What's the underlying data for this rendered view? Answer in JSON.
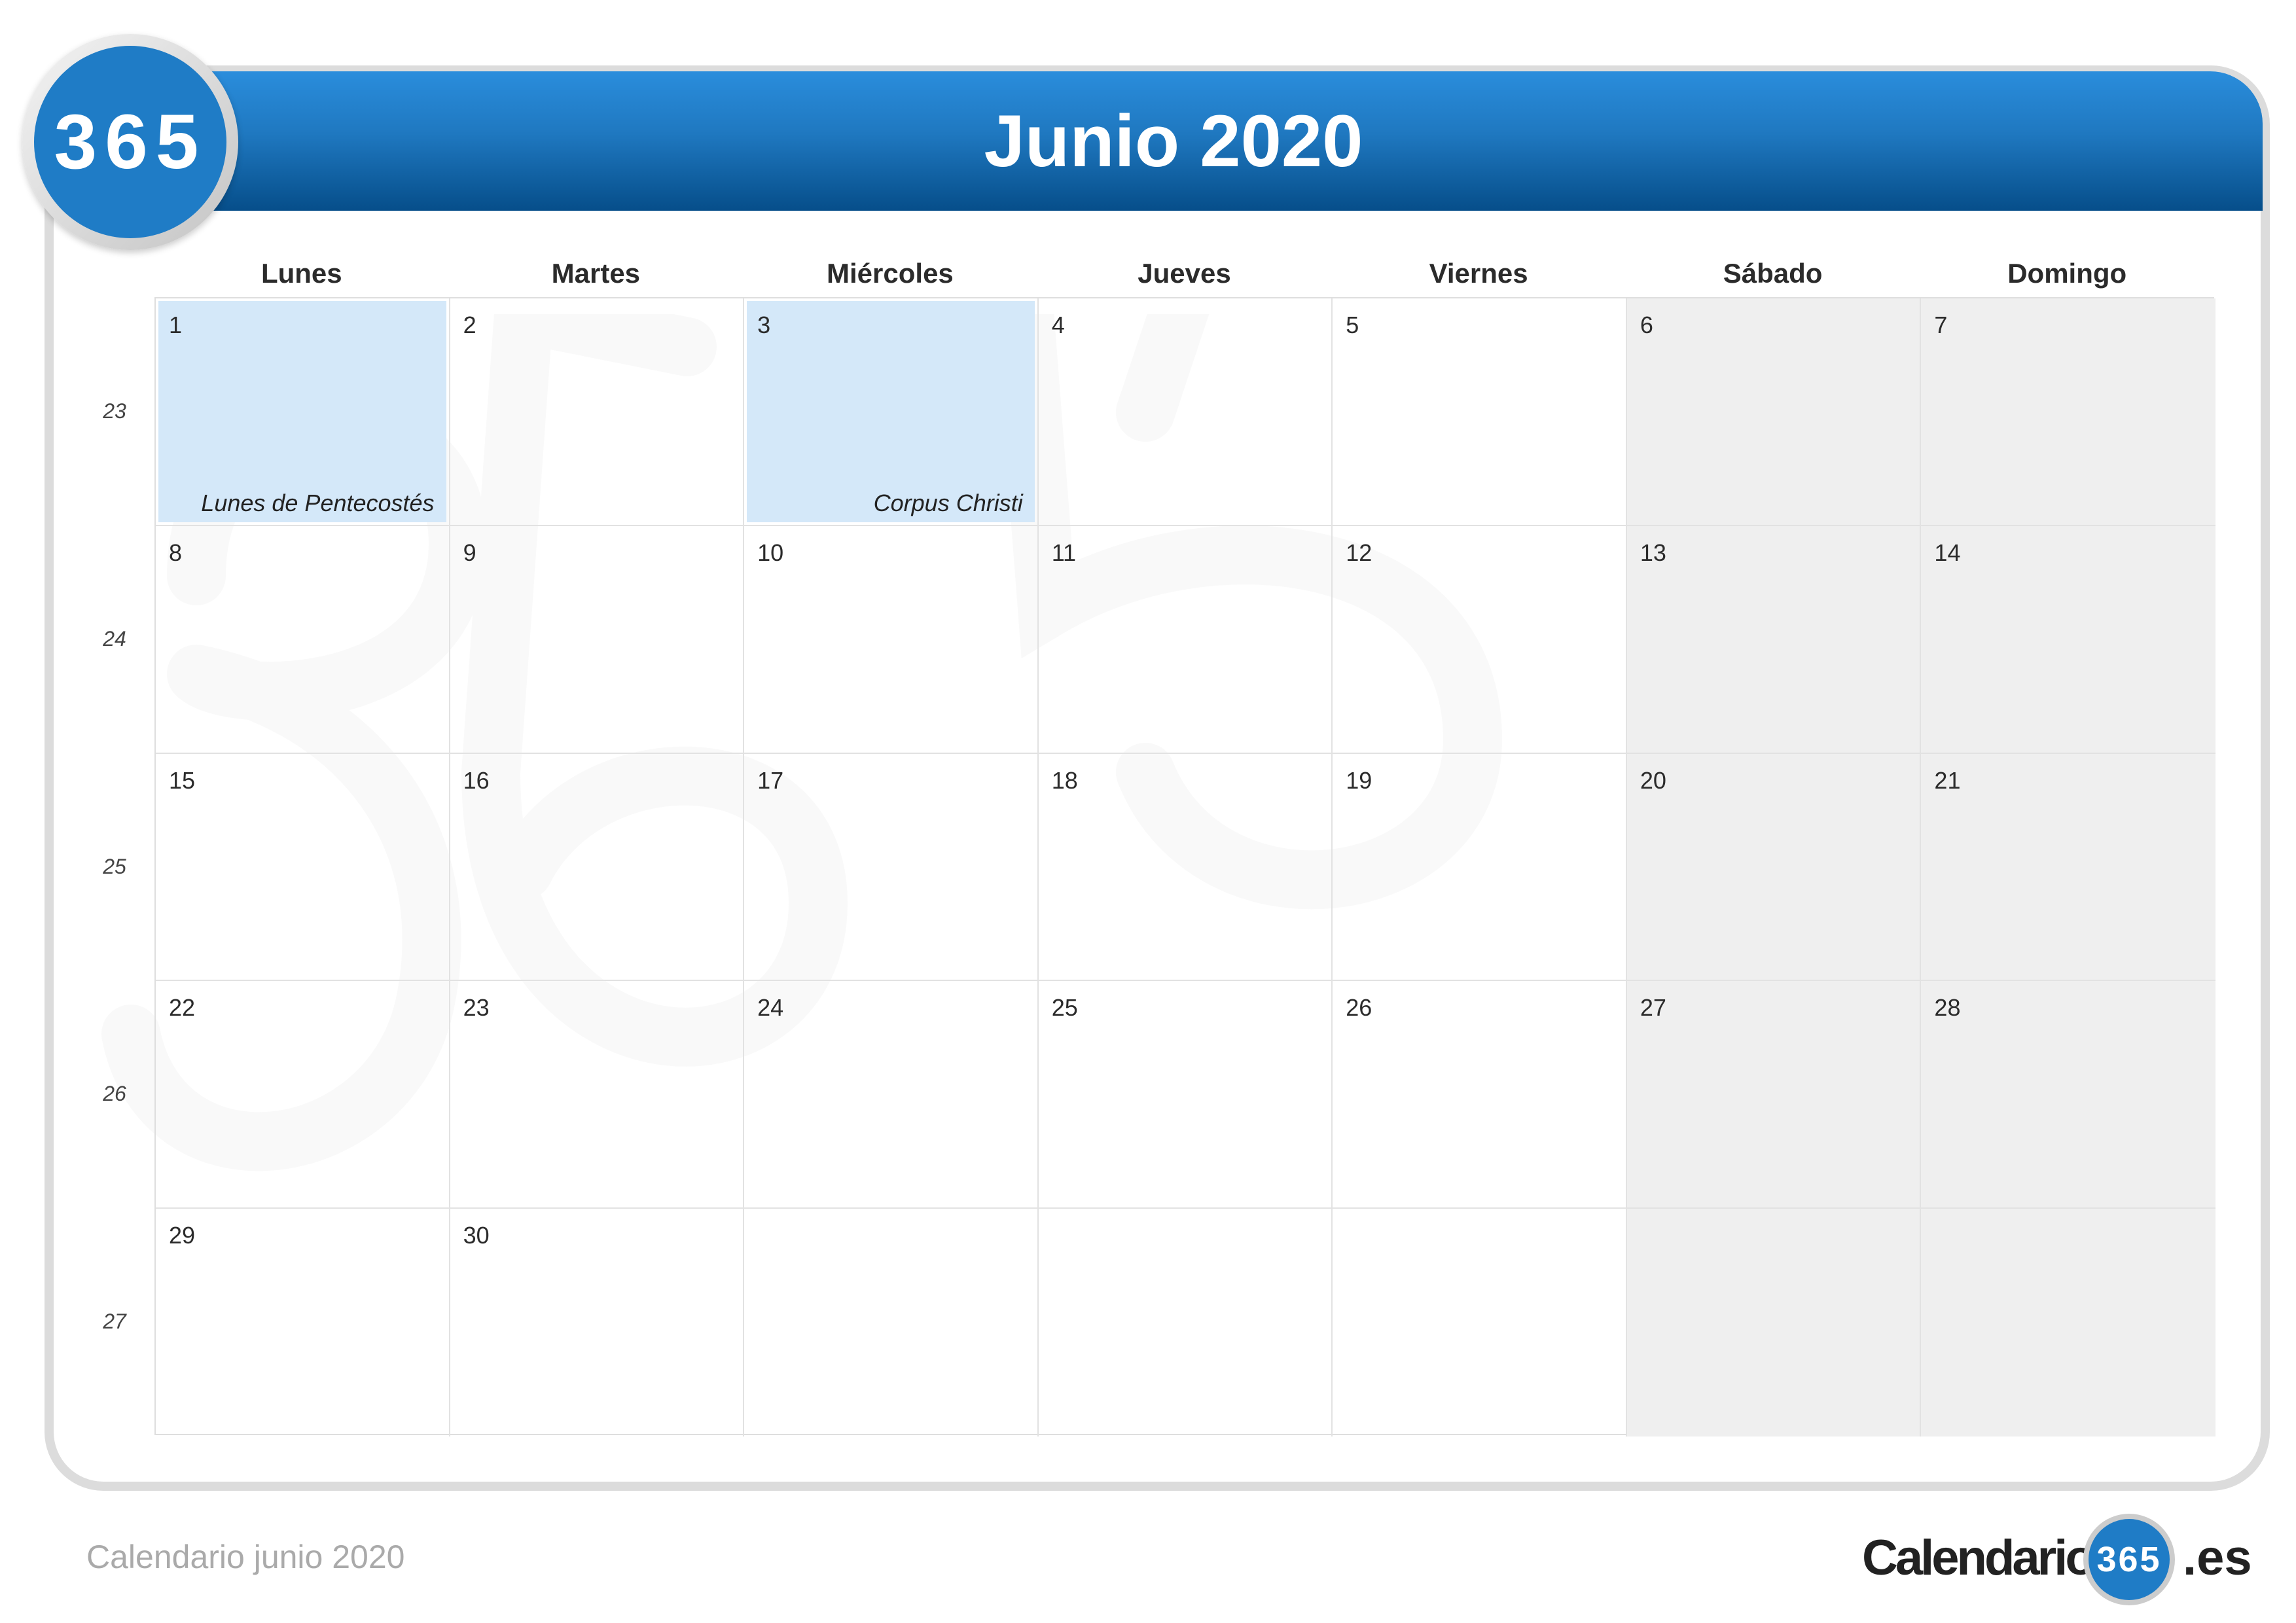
{
  "logo": {
    "text": "365"
  },
  "header": {
    "title": "Junio 2020",
    "color": "#1f7cc6"
  },
  "weekdays": [
    "Lunes",
    "Martes",
    "Miércoles",
    "Jueves",
    "Viernes",
    "Sábado",
    "Domingo"
  ],
  "weeks": [
    {
      "number": "23",
      "days": [
        "1",
        "2",
        "3",
        "4",
        "5",
        "6",
        "7"
      ]
    },
    {
      "number": "24",
      "days": [
        "8",
        "9",
        "10",
        "11",
        "12",
        "13",
        "14"
      ]
    },
    {
      "number": "25",
      "days": [
        "15",
        "16",
        "17",
        "18",
        "19",
        "20",
        "21"
      ]
    },
    {
      "number": "26",
      "days": [
        "22",
        "23",
        "24",
        "25",
        "26",
        "27",
        "28"
      ]
    },
    {
      "number": "27",
      "days": [
        "29",
        "30",
        "",
        "",
        "",
        "",
        ""
      ]
    }
  ],
  "holidays": [
    {
      "day": "1",
      "name": "Lunes de Pentecostés"
    },
    {
      "day": "3",
      "name": "Corpus Christi"
    }
  ],
  "colors": {
    "holiday": "#d4e8f9",
    "weekend": "#efefef"
  },
  "footer": {
    "caption": "Calendario junio 2020",
    "brand_left": "Calendario",
    "brand_badge": "365",
    "brand_right": ".es"
  }
}
